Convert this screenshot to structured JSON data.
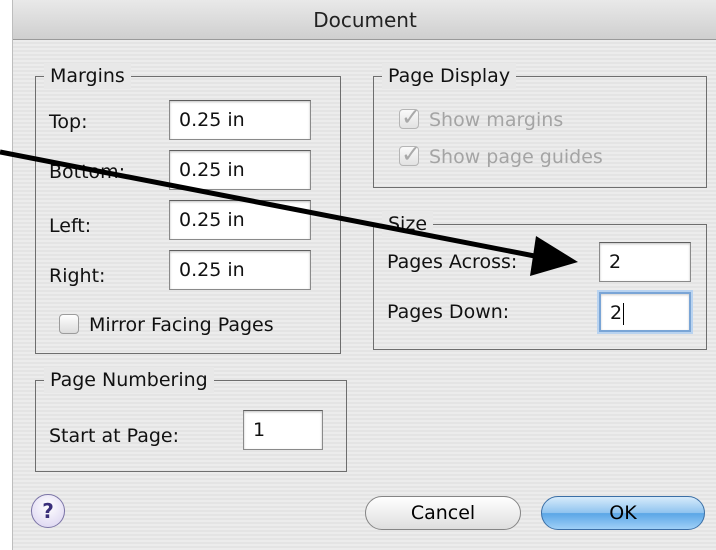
{
  "window": {
    "title": "Document"
  },
  "margins": {
    "legend": "Margins",
    "top_label": "Top:",
    "top_value": "0.25 in",
    "bottom_label": "Bottom:",
    "bottom_value": "0.25 in",
    "left_label": "Left:",
    "left_value": "0.25 in",
    "right_label": "Right:",
    "right_value": "0.25 in",
    "mirror_label": "Mirror Facing Pages",
    "mirror_checked": false
  },
  "page_display": {
    "legend": "Page Display",
    "show_margins_label": "Show margins",
    "show_margins_checked": true,
    "show_guides_label": "Show page guides",
    "show_guides_checked": true
  },
  "size": {
    "legend": "Size",
    "across_label": "Pages Across:",
    "across_value": "2",
    "down_label": "Pages Down:",
    "down_value": "2"
  },
  "page_numbering": {
    "legend": "Page Numbering",
    "start_label": "Start at Page:",
    "start_value": "1"
  },
  "buttons": {
    "help": "?",
    "cancel": "Cancel",
    "ok": "OK"
  },
  "icons": {
    "help": "help-icon",
    "checkmark": "checkmark-icon",
    "annotation_arrow": "arrow-icon"
  },
  "colors": {
    "ok_button": "#5aa6e6",
    "focus_ring": "#7aa5d6",
    "disabled_text": "#a4a4a4"
  }
}
